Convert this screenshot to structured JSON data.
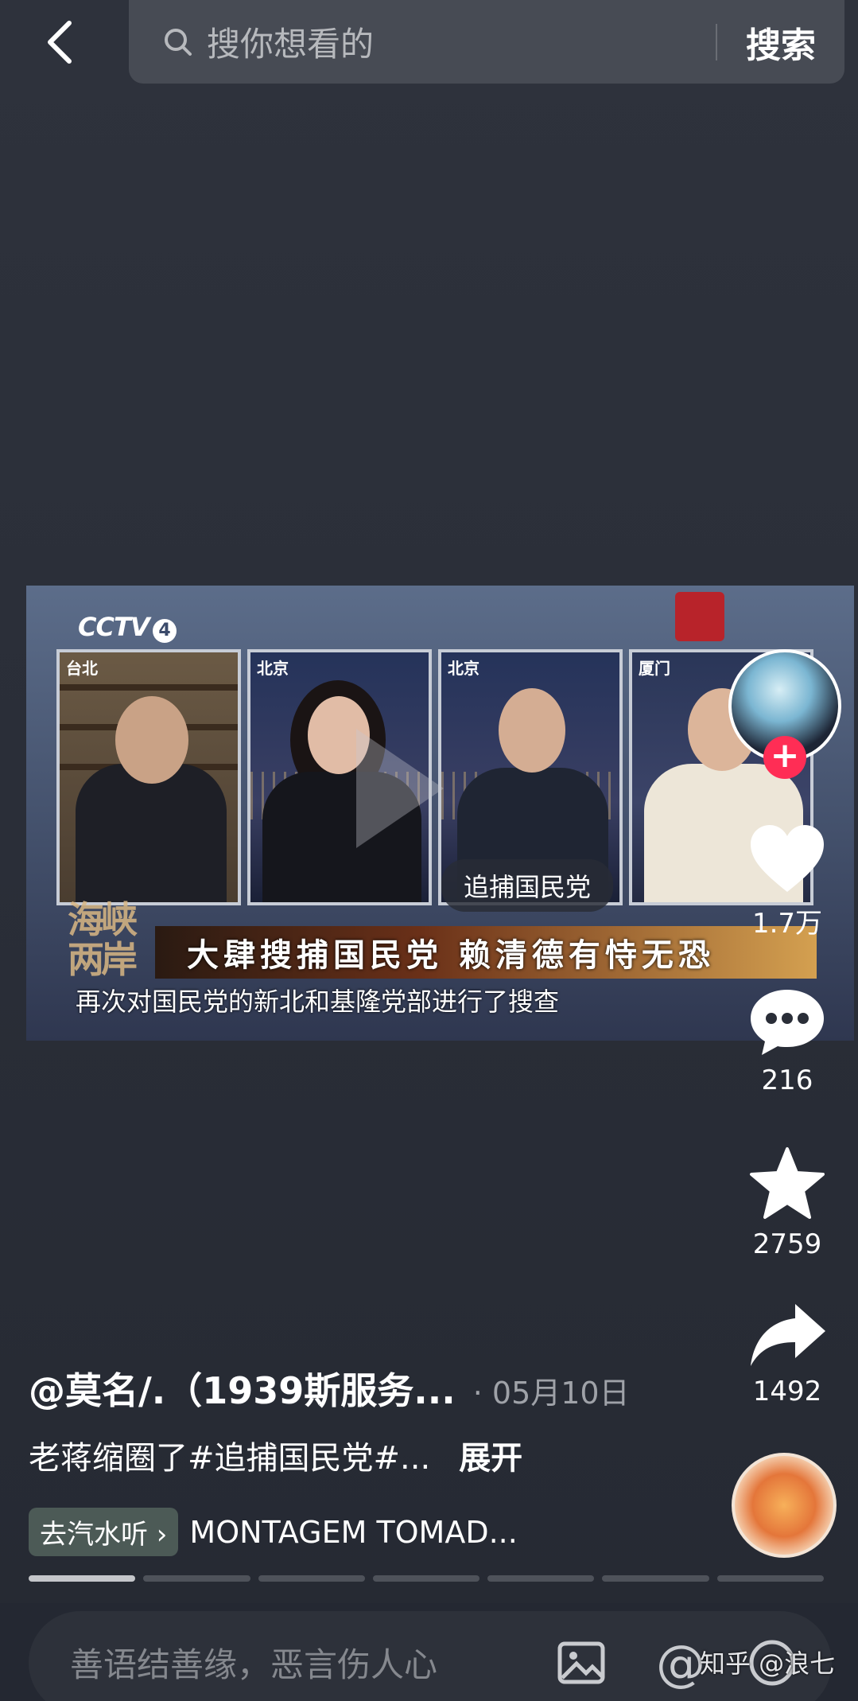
{
  "search": {
    "placeholder": "搜你想看的",
    "button_label": "搜索"
  },
  "video": {
    "channel_logo": "CCTV",
    "channel_number": "4",
    "panels": [
      {
        "city": "台北"
      },
      {
        "city": "北京"
      },
      {
        "city": "北京"
      },
      {
        "city": "厦门"
      }
    ],
    "tag_chip": "追捕国民党",
    "show_logo": "海峡两岸",
    "headline": "大肆搜捕国民党  赖清德有恃无恐",
    "subtitle": "再次对国民党的新北和基隆党部进行了搜查"
  },
  "actions": {
    "likes": "1.7万",
    "comments": "216",
    "favorites": "2759",
    "shares": "1492"
  },
  "post": {
    "author": "@莫名/.（1939斯服务...",
    "date": "· 05月10日",
    "description": "老蒋缩圈了#追捕国民党#...",
    "expand_label": "展开",
    "music_chip": "去汽水听 ›",
    "music_title": "MONTAGEM TOMAD..."
  },
  "progress": {
    "segments": 7,
    "active_index": 0
  },
  "comment_bar": {
    "placeholder": "善语结善缘，恶言伤人心",
    "watermark": "知乎 @浪七"
  },
  "colors": {
    "background": "#242832",
    "accent_follow": "#ff2d55"
  }
}
